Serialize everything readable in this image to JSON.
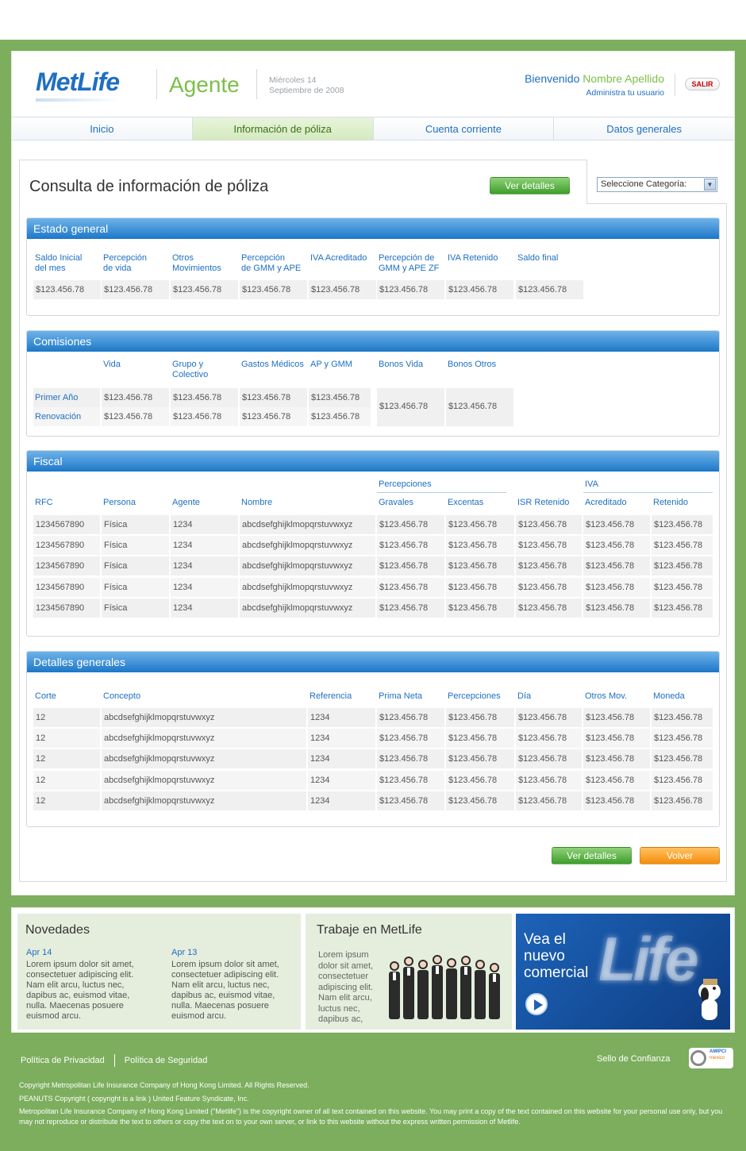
{
  "header": {
    "logo": "MetLife",
    "section": "Agente",
    "date_line1": "Miércoles 14",
    "date_line2": "Septiembre de 2008",
    "welcome": "Bienvenido",
    "user_name": "Nombre Apellido",
    "admin_link": "Administra tu usuario",
    "logout": "SALIR"
  },
  "nav": [
    {
      "label": "Inicio",
      "active": false
    },
    {
      "label": "Información de póliza",
      "active": true
    },
    {
      "label": "Cuenta corriente",
      "active": false
    },
    {
      "label": "Datos generales",
      "active": false
    }
  ],
  "page": {
    "title": "Consulta de información de póliza",
    "details_button": "Ver detalles",
    "category_select": "Seleccione Categoría:",
    "back_button": "Volver"
  },
  "estado": {
    "title": "Estado general",
    "headers": [
      [
        "Saldo Inicial",
        "del mes"
      ],
      [
        "Percepción",
        "de vida"
      ],
      [
        "Otros",
        "Movimientos"
      ],
      [
        "Percepción",
        "de GMM y APE"
      ],
      [
        "",
        "IVA Acreditado"
      ],
      [
        "Percepción de",
        "GMM y APE ZF"
      ],
      [
        "",
        "IVA Retenido"
      ],
      [
        "",
        "Saldo final"
      ]
    ],
    "values": [
      "$123.456.78",
      "$123.456.78",
      "$123.456.78",
      "$123.456.78",
      "$123.456.78",
      "$123.456.78",
      "$123.456.78",
      "$123.456.78"
    ]
  },
  "comisiones": {
    "title": "Comisiones",
    "headers": [
      [
        "",
        "Vida"
      ],
      [
        "Grupo y",
        "Colectivo"
      ],
      [
        "",
        "Gastos Médicos"
      ],
      [
        "",
        "AP y GMM"
      ],
      [
        "",
        "Bonos Vida"
      ],
      [
        "",
        "Bonos Otros"
      ]
    ],
    "rows": [
      {
        "label": "Primer Año",
        "values": [
          "$123.456.78",
          "$123.456.78",
          "$123.456.78",
          "$123.456.78"
        ]
      },
      {
        "label": "Renovación",
        "values": [
          "$123.456.78",
          "$123.456.78",
          "$123.456.78",
          "$123.456.78"
        ]
      }
    ],
    "bonos": [
      "$123.456.78",
      "$123.456.78"
    ]
  },
  "fiscal": {
    "title": "Fiscal",
    "group_percepciones": "Percepciones",
    "group_iva": "IVA",
    "headers": [
      "RFC",
      "Persona",
      "Agente",
      "Nombre",
      "Gravales",
      "Excentas",
      "ISR Retenido",
      "Acreditado",
      "Retenido"
    ],
    "rows": [
      [
        "1234567890",
        "Física",
        "1234",
        "abcdsefghijklmopqrstuvwxyz",
        "$123.456.78",
        "$123.456.78",
        "$123.456.78",
        "$123.456.78",
        "$123.456.78"
      ],
      [
        "1234567890",
        "Física",
        "1234",
        "abcdsefghijklmopqrstuvwxyz",
        "$123.456.78",
        "$123.456.78",
        "$123.456.78",
        "$123.456.78",
        "$123.456.78"
      ],
      [
        "1234567890",
        "Física",
        "1234",
        "abcdsefghijklmopqrstuvwxyz",
        "$123.456.78",
        "$123.456.78",
        "$123.456.78",
        "$123.456.78",
        "$123.456.78"
      ],
      [
        "1234567890",
        "Física",
        "1234",
        "abcdsefghijklmopqrstuvwxyz",
        "$123.456.78",
        "$123.456.78",
        "$123.456.78",
        "$123.456.78",
        "$123.456.78"
      ],
      [
        "1234567890",
        "Física",
        "1234",
        "abcdsefghijklmopqrstuvwxyz",
        "$123.456.78",
        "$123.456.78",
        "$123.456.78",
        "$123.456.78",
        "$123.456.78"
      ]
    ]
  },
  "detalles": {
    "title": "Detalles generales",
    "headers": [
      "Corte",
      "Concepto",
      "Referencia",
      "Prima Neta",
      "Percepciones",
      "Día",
      "Otros Mov.",
      "Moneda"
    ],
    "rows": [
      [
        "12",
        "abcdsefghijklmopqrstuvwxyz",
        "1234",
        "$123.456.78",
        "$123.456.78",
        "$123.456.78",
        "$123.456.78",
        "$123.456.78"
      ],
      [
        "12",
        "abcdsefghijklmopqrstuvwxyz",
        "1234",
        "$123.456.78",
        "$123.456.78",
        "$123.456.78",
        "$123.456.78",
        "$123.456.78"
      ],
      [
        "12",
        "abcdsefghijklmopqrstuvwxyz",
        "1234",
        "$123.456.78",
        "$123.456.78",
        "$123.456.78",
        "$123.456.78",
        "$123.456.78"
      ],
      [
        "12",
        "abcdsefghijklmopqrstuvwxyz",
        "1234",
        "$123.456.78",
        "$123.456.78",
        "$123.456.78",
        "$123.456.78",
        "$123.456.78"
      ],
      [
        "12",
        "abcdsefghijklmopqrstuvwxyz",
        "1234",
        "$123.456.78",
        "$123.456.78",
        "$123.456.78",
        "$123.456.78",
        "$123.456.78"
      ]
    ]
  },
  "novedades": {
    "title": "Novedades",
    "items": [
      {
        "date": "Apr 14",
        "text": "Lorem ipsum dolor sit amet, consectetuer adipiscing elit. Nam elit arcu, luctus nec, dapibus ac, euismod vitae, nulla. Maecenas posuere euismod arcu."
      },
      {
        "date": "Apr 13",
        "text": "Lorem ipsum dolor sit amet, consectetuer adipiscing elit. Nam elit arcu, luctus nec, dapibus ac, euismod vitae, nulla. Maecenas posuere euismod arcu."
      }
    ]
  },
  "trabaje": {
    "title": "Trabaje en MetLife",
    "text": "Lorem ipsum dolor sit amet, consectetuer adipiscing elit. Nam elit arcu, luctus nec, dapibus ac,"
  },
  "promo": {
    "line1": "Vea el",
    "line2": "nuevo",
    "line3": "comercial",
    "brand": "Life"
  },
  "footer": {
    "privacy": "Política de Privacidad",
    "security": "Política de Seguridad",
    "seal": "Sello de Confianza",
    "amipci_label": "AMIPCI",
    "amipci_sub": "mexico",
    "copy1": "Copyright Metropolitan Life Insurance Company of Hong Kong Limited. All Rights Reserved.",
    "copy2": "PEANUTS Copyright ( copyright is a link ) United Feature Syndicate, Inc.",
    "copy3": "Metropolitan Life Insurance Company of Hong Kong Limited (\"Metlife\") is the copyright owner of all text contained on this website. You may print a copy of the text contained on this website for your personal use only, but you may not reproduce or distribute the text to others or copy the text on to your own server, or link to this website without the express written permission of Metlife."
  },
  "colors": {
    "brand_blue": "#1f6fc1",
    "brand_green": "#7cbf4a",
    "page_green": "#7cae5e",
    "button_orange": "#f58d0e"
  }
}
